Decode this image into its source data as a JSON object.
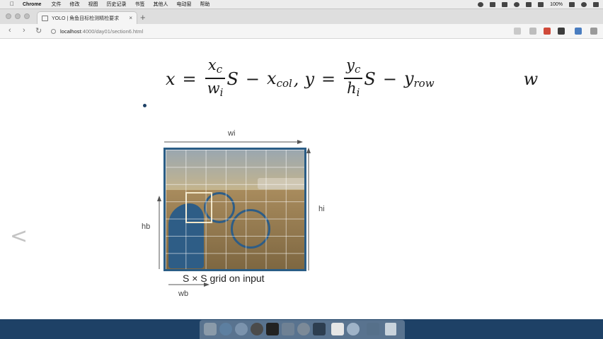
{
  "menubar": {
    "app": "Chrome",
    "items": [
      "文件",
      "修改",
      "视图",
      "历史记录",
      "书签",
      "其他人",
      "电动窗",
      "帮助"
    ],
    "battery": "100%"
  },
  "tab": {
    "title": "YOLO | 角鱼目标检测精检要求",
    "close": "×"
  },
  "newtab": "+",
  "address": {
    "host": "localhost",
    "path": ":4000/day01/section6.html"
  },
  "nav": {
    "back": "‹",
    "forward": "›",
    "reload": "↻"
  },
  "formula": {
    "x": "x",
    "eq": "=",
    "xc": "x",
    "c": "c",
    "wi": "w",
    "i": "i",
    "S": "S",
    "minus": "−",
    "xcol": "x",
    "col": "col",
    "comma": ",",
    "y": "y",
    "yc": "y",
    "hi": "h",
    "yrow": "y",
    "row": "row",
    "w": "w"
  },
  "figure": {
    "wi": "wi",
    "hi": "hi",
    "hb": "hb",
    "wb": "wb",
    "caption": "S × S grid on input"
  },
  "colors": {
    "accent": "#2a5d86",
    "desktop": "#1e4166"
  }
}
